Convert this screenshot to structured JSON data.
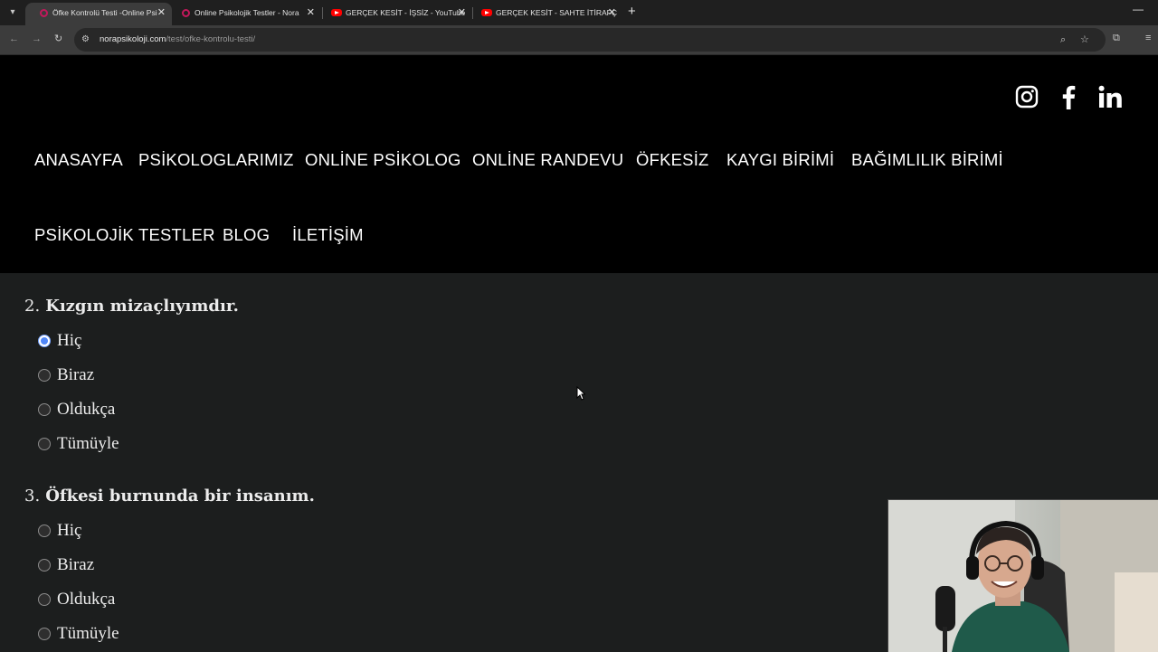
{
  "browser": {
    "tabs": [
      {
        "title": "Öfke Kontrolü Testi -Online Psi",
        "active": true,
        "favicon": "nora-logo-icon"
      },
      {
        "title": "Online Psikolojik Testler - Nora",
        "active": false,
        "favicon": "nora-logo-icon"
      },
      {
        "title": "GERÇEK KESİT - İŞSİZ - YouTube",
        "active": false,
        "favicon": "youtube-icon"
      },
      {
        "title": "GERÇEK KESİT - SAHTE İTİRAFÇ",
        "active": false,
        "favicon": "youtube-icon"
      }
    ],
    "url_domain": "norapsikoloji.com",
    "url_path": "/test/ofke-kontrolu-testi/"
  },
  "header": {
    "social": [
      "instagram-icon",
      "facebook-icon",
      "linkedin-icon"
    ],
    "nav": [
      "ANASAYFA",
      "PSİKOLOGLARIMIZ",
      "ONLİNE PSİKOLOG",
      "ONLİNE RANDEVU",
      "ÖFKESİZ",
      "KAYGI BİRİMİ",
      "BAĞIMLILIK BİRİMİ",
      "PSİKOLOJİK TESTLER",
      "BLOG",
      "İLETİŞİM"
    ]
  },
  "questions": [
    {
      "number": "2.",
      "text": "Kızgın mizaçlıyımdır.",
      "options": [
        "Hiç",
        "Biraz",
        "Oldukça",
        "Tümüyle"
      ],
      "selected": "Hiç"
    },
    {
      "number": "3.",
      "text": "Öfkesi burnunda bir insanım.",
      "options": [
        "Hiç",
        "Biraz",
        "Oldukça",
        "Tümüyle"
      ],
      "selected": null
    }
  ],
  "colors": {
    "accent": "#4f86f7",
    "header_bg": "#000000",
    "page_bg": "#1c1e1e"
  }
}
